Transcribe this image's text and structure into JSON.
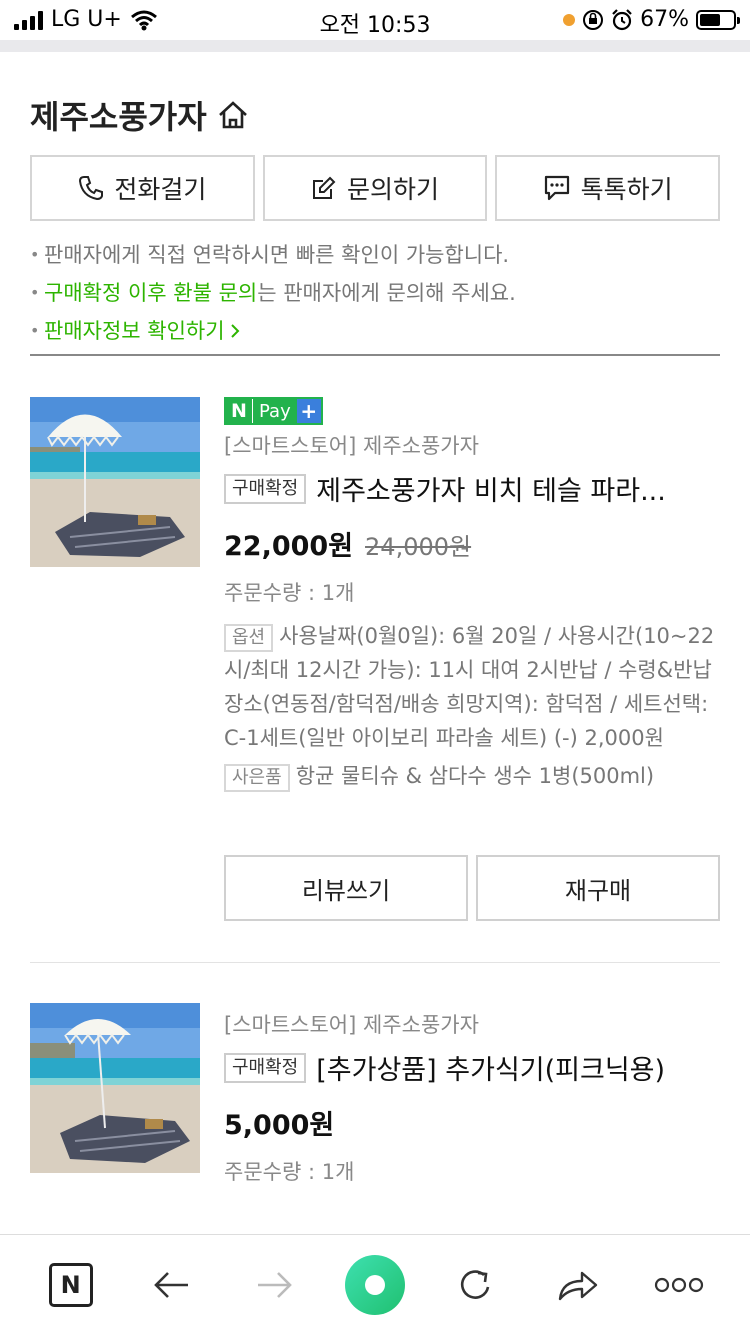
{
  "status_bar": {
    "carrier": "LG U+",
    "time": "오전 10:53",
    "battery": "67%"
  },
  "seller": {
    "name": "제주소풍가자",
    "icon": "home-icon",
    "buttons": [
      {
        "label": "전화걸기",
        "icon": "phone-icon"
      },
      {
        "label": "문의하기",
        "icon": "edit-icon"
      },
      {
        "label": "톡톡하기",
        "icon": "chat-icon"
      }
    ],
    "notes": {
      "line1": "판매자에게 직접 연락하시면 빠른 확인이 가능합니다.",
      "line2_link": "구매확정 이후 환불 문의",
      "line2_rest": "는 판매자에게 문의해 주세요.",
      "line3_link": "판매자정보 확인하기"
    },
    "accent_color": "#2db400"
  },
  "products": [
    {
      "pay_badge": {
        "n": "N",
        "pay": "Pay",
        "plus": "+"
      },
      "store": "[스마트스토어] 제주소풍가자",
      "status": "구매확정",
      "name": "제주소풍가자 비치 테슬 파라...",
      "price": "22,000원",
      "original_price": "24,000원",
      "quantity": "주문수량 : 1개",
      "option_tag": "옵션",
      "option_text": "사용날짜(0월0일): 6월 20일 / 사용시간(10~22시/최대 12시간 가능): 11시 대여 2시반납 / 수령&반납장소(연동점/함덕점/배송 희망지역): 함덕점 / 세트선택: C-1세트(일반 아이보리 파라솔 세트) (-) 2,000원",
      "gift_tag": "사은품",
      "gift_text": "항균 물티슈 & 삼다수 생수 1병(500ml)",
      "review_button": "리뷰쓰기",
      "rebuy_button": "재구매"
    },
    {
      "store": "[스마트스토어] 제주소풍가자",
      "status": "구매확정",
      "name": "[추가상품] 추가식기(피크닉용)",
      "price": "5,000원",
      "quantity": "주문수량 : 1개"
    }
  ],
  "bottom_bar": {
    "items": [
      "naver-home-icon",
      "back-icon",
      "forward-icon",
      "green-dot-icon",
      "refresh-icon",
      "share-icon",
      "more-icon"
    ],
    "home_label": "N"
  }
}
